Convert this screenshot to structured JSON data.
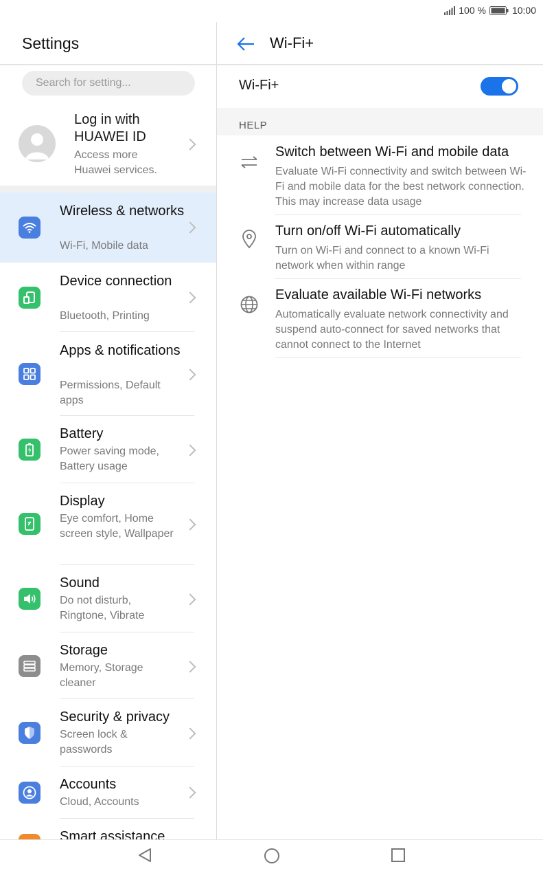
{
  "status": {
    "battery_text": "100 %",
    "time": "10:00"
  },
  "left": {
    "title": "Settings",
    "search_placeholder": "Search for setting...",
    "account": {
      "title": "Log in with HUAWEI ID",
      "subtitle": "Access more Huawei services."
    },
    "items": [
      {
        "title": "Wireless & networks",
        "subtitle": "Wi-Fi, Mobile data",
        "color": "#4a7fe0",
        "icon": "wifi-icon"
      },
      {
        "title": "Device connection",
        "subtitle": "Bluetooth, Printing",
        "color": "#35c06c",
        "icon": "device-connection-icon"
      },
      {
        "title": "Apps & notifications",
        "subtitle": "Permissions, Default apps",
        "color": "#4a7fe0",
        "icon": "apps-icon"
      },
      {
        "title": "Battery",
        "subtitle": "Power saving mode, Battery usage",
        "color": "#35c06c",
        "icon": "battery-icon"
      },
      {
        "title": "Display",
        "subtitle": "Eye comfort, Home screen style, Wallpaper",
        "color": "#35c06c",
        "icon": "display-icon"
      },
      {
        "title": "Sound",
        "subtitle": "Do not disturb, Ringtone, Vibrate",
        "color": "#35c06c",
        "icon": "sound-icon"
      },
      {
        "title": "Storage",
        "subtitle": "Memory, Storage cleaner",
        "color": "#8d8d8d",
        "icon": "storage-icon"
      },
      {
        "title": "Security & privacy",
        "subtitle": "Screen lock & passwords",
        "color": "#4a7fe0",
        "icon": "shield-icon"
      },
      {
        "title": "Accounts",
        "subtitle": "Cloud, Accounts",
        "color": "#4a7fe0",
        "icon": "account-icon"
      },
      {
        "title": "Smart assistance",
        "subtitle": "",
        "color": "#f08a2a",
        "icon": "smart-assistance-icon"
      }
    ]
  },
  "right": {
    "title": "Wi-Fi+",
    "toggle_label": "Wi-Fi+",
    "toggle_on": true,
    "help_header": "HELP",
    "help_items": [
      {
        "title": "Switch between Wi-Fi and mobile data",
        "description": "Evaluate Wi-Fi connectivity and switch between Wi-Fi and mobile data for the best network connection. This may increase data usage",
        "icon": "swap-arrows-icon"
      },
      {
        "title": "Turn on/off Wi-Fi automatically",
        "description": "Turn on Wi-Fi and connect to a known Wi-Fi network when within range",
        "icon": "location-pin-icon"
      },
      {
        "title": "Evaluate available Wi-Fi networks",
        "description": "Automatically evaluate network connectivity and suspend auto-connect for saved networks that cannot connect to the Internet",
        "icon": "globe-icon"
      }
    ]
  }
}
